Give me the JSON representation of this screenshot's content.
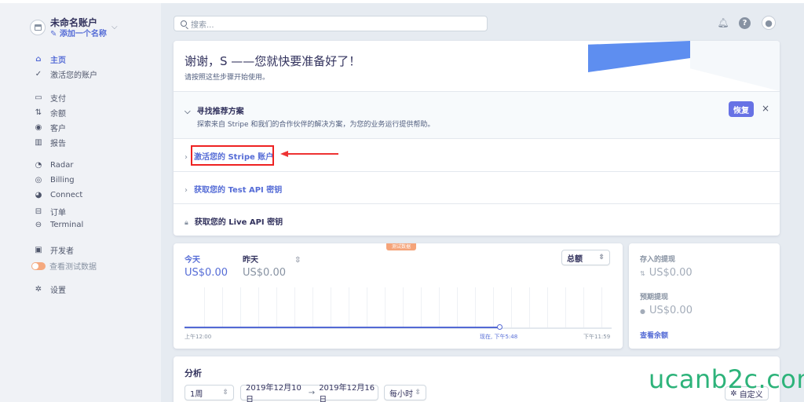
{
  "account": {
    "name": "未命名账户",
    "add_name": "添加一个名称"
  },
  "nav": {
    "home": "主页",
    "activate": "激活您的账户",
    "payments": "支付",
    "balance": "余额",
    "customers": "客户",
    "reports": "报告",
    "radar": "Radar",
    "billing": "Billing",
    "connect": "Connect",
    "orders": "订单",
    "terminal": "Terminal",
    "developers": "开发者",
    "test_data": "查看测试数据",
    "settings": "设置"
  },
  "search": {
    "placeholder": "搜索..."
  },
  "welcome": {
    "title": "谢谢，S          ——您就快要准备好了！",
    "subtitle": "请按照这些步骤开始使用。"
  },
  "recommend": {
    "title": "寻找推荐方案",
    "desc": "探索来自 Stripe 和我们的合作伙伴的解决方案，为您的业务运行提供帮助。",
    "restore": "恢复",
    "close": "×"
  },
  "steps": [
    "激活您的 Stripe 账户",
    "获取您的 Test API 密钥",
    "获取您的 Live API 密钥"
  ],
  "stats": {
    "badge": "测试数据",
    "today_label": "今天",
    "today_value": "US$0.00",
    "yesterday_label": "昨天",
    "yesterday_value": "US$0.00",
    "metric": "总额",
    "time_start": "上午12:00",
    "time_now": "现在, 下午5:48",
    "time_end": "下午11:59"
  },
  "balances": {
    "deposit_label": "存入的提现",
    "deposit_value": "US$0.00",
    "expected_label": "预期提现",
    "expected_value": "US$0.00",
    "link": "查看余额"
  },
  "analysis": {
    "title": "分析",
    "period": "1周",
    "range_start": "2019年12月10日",
    "range_end": "2019年12月16日",
    "interval": "每小时",
    "custom": "自定义"
  },
  "watermark": "ucanb2c.com",
  "colors": {
    "accent": "#556cd6",
    "primary_button": "#6772e5",
    "highlight": "#ee2222",
    "watermark": "#2db37a"
  }
}
